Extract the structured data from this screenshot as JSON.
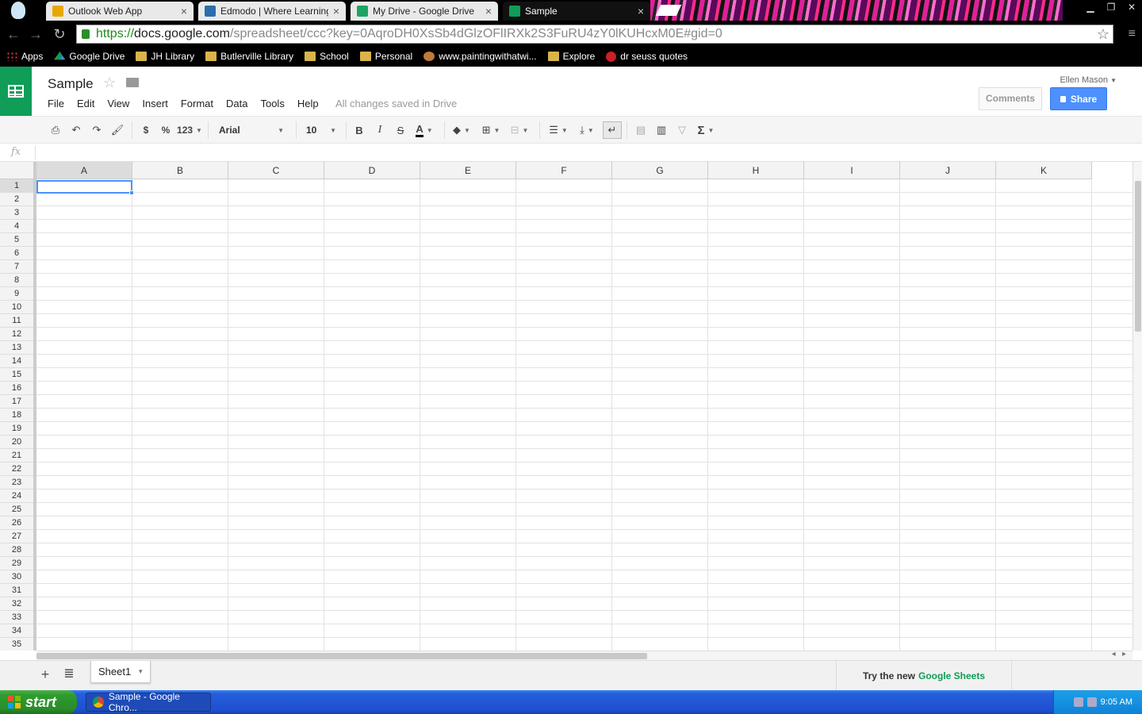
{
  "browser": {
    "tabs": [
      {
        "label": "Outlook Web App",
        "icon": "outlook-icon",
        "color": "#e8a800"
      },
      {
        "label": "Edmodo | Where Learning Ha",
        "icon": "edmodo-icon",
        "color": "#2b6dad"
      },
      {
        "label": "My Drive - Google Drive",
        "icon": "google-drive-icon",
        "color": "#1da462"
      },
      {
        "label": "Sample",
        "icon": "sheets-icon",
        "color": "#0f9d58"
      }
    ],
    "url_scheme": "https://",
    "url_host": "docs.google.com",
    "url_path": "/spreadsheet/ccc?key=0AqroDH0XsSb4dGlzOFlIRXk2S3FuRU4zY0lKUHcxM0E#gid=0",
    "bookmarks": [
      {
        "label": "Apps",
        "icon": "apps-grid-icon"
      },
      {
        "label": "Google Drive",
        "icon": "google-drive-icon"
      },
      {
        "label": "JH Library",
        "icon": "folder-icon"
      },
      {
        "label": "Butlerville Library",
        "icon": "folder-icon"
      },
      {
        "label": "School",
        "icon": "folder-icon"
      },
      {
        "label": "Personal",
        "icon": "folder-icon"
      },
      {
        "label": "www.paintingwithatwi...",
        "icon": "paint-palette-icon"
      },
      {
        "label": "Explore",
        "icon": "folder-icon"
      },
      {
        "label": "dr seuss quotes",
        "icon": "pinterest-icon"
      }
    ]
  },
  "doc": {
    "title": "Sample",
    "menus": [
      "File",
      "Edit",
      "View",
      "Insert",
      "Format",
      "Data",
      "Tools",
      "Help"
    ],
    "save_status": "All changes saved in Drive",
    "user": "Ellen Mason",
    "comments_label": "Comments",
    "share_label": "Share"
  },
  "toolbar": {
    "currency": "$",
    "percent": "%",
    "number_format": "123",
    "font": "Arial",
    "font_size": "10",
    "bold": "B",
    "italic": "I",
    "strike": "S",
    "text_color": "A",
    "sum": "Σ"
  },
  "formula": {
    "fx": "fx",
    "value": ""
  },
  "grid": {
    "columns": [
      "A",
      "B",
      "C",
      "D",
      "E",
      "F",
      "G",
      "H",
      "I",
      "J",
      "K"
    ],
    "rows": [
      "1",
      "2",
      "3",
      "4",
      "5",
      "6",
      "7",
      "8",
      "9",
      "10",
      "11",
      "12",
      "13",
      "14",
      "15",
      "16",
      "17",
      "18",
      "19",
      "20",
      "21",
      "22",
      "23",
      "24",
      "25",
      "26",
      "27",
      "28",
      "29",
      "30",
      "31",
      "32",
      "33",
      "34",
      "35"
    ],
    "selected_cell": "A1"
  },
  "sheets": {
    "tabs": [
      "Sheet1"
    ],
    "promo_text": "Try the new",
    "promo_brand": "Google Sheets"
  },
  "taskbar": {
    "start_label": "start",
    "task_label": "Sample - Google Chro...",
    "clock": "9:05 AM"
  },
  "colors": {
    "sheets_green": "#0f9d58",
    "share_blue": "#4d90fe",
    "xp_blue": "#245edb"
  }
}
